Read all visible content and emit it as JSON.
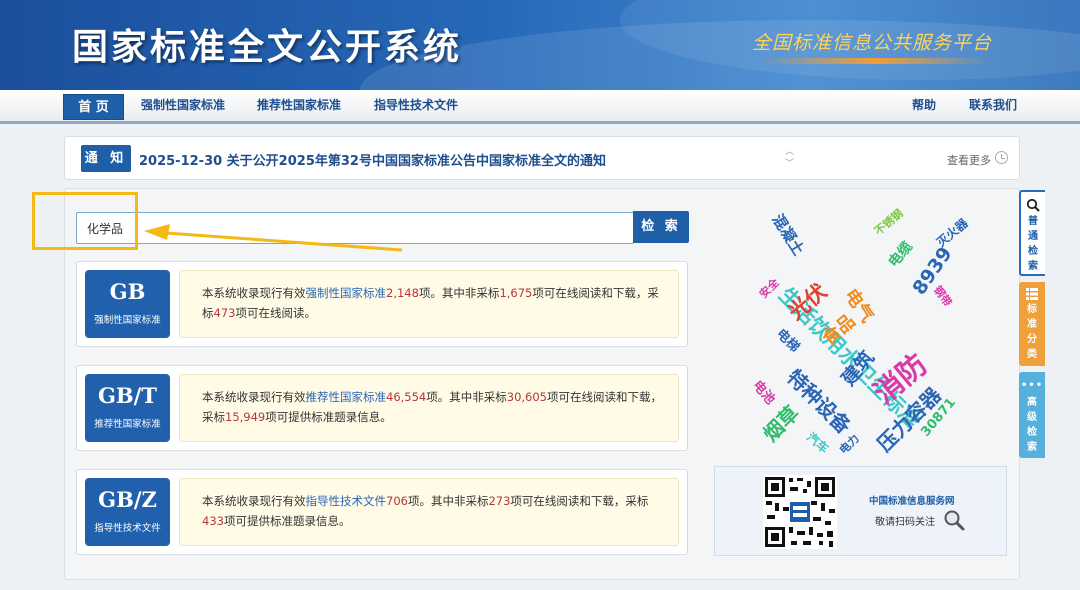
{
  "header": {
    "title": "国家标准全文公开系统",
    "slogan": "全国标准信息公共服务平台"
  },
  "nav": {
    "home": "首 页",
    "items": [
      "强制性国家标准",
      "推荐性国家标准",
      "指导性技术文件"
    ],
    "right": [
      "帮助",
      "联系我们"
    ]
  },
  "notice": {
    "badge": "通 知",
    "text": "2025-12-30  关于公开2025年第32号中国国家标准公告中国家标准全文的通知",
    "more": "查看更多"
  },
  "search": {
    "value": "化学品",
    "button": "检 索"
  },
  "cards": [
    {
      "code": "GB",
      "sub": "强制性国家标准",
      "t1": "本系统收录现行有效",
      "type": "强制性国家标准",
      "total": "2,148",
      "t2": "项。其中非采标",
      "nonadopt": "1,675",
      "t3": "项可在线阅读和下载，采标",
      "adopt": "473",
      "t4": "项可在线阅读。"
    },
    {
      "code": "GB/T",
      "sub": "推荐性国家标准",
      "t1": "本系统收录现行有效",
      "type": "推荐性国家标准",
      "total": "46,554",
      "t2": "项。其中非采标",
      "nonadopt": "30,605",
      "t3": "项可在线阅读和下载，采标",
      "adopt": "15,949",
      "t4": "项可提供标准题录信息。"
    },
    {
      "code": "GB/Z",
      "sub": "指导性技术文件",
      "t1": "本系统收录现行有效",
      "type": "指导性技术文件",
      "total": "706",
      "t2": "项。其中非采标",
      "nonadopt": "273",
      "t3": "项可在线阅读和下载，采标",
      "adopt": "433",
      "t4": "项可提供标准题录信息。"
    }
  ],
  "cloud": {
    "words": [
      "混凝土",
      "生活饮用水卫生标准",
      "不锈钢",
      "灭火器",
      "电缆",
      "8939",
      "安全",
      "光伏",
      "电气",
      "钢带",
      "食品",
      "电梯",
      "建筑",
      "消防",
      "特种设备",
      "电池",
      "压力容器",
      "烟草",
      "汽车",
      "电力",
      "30871"
    ]
  },
  "qr": {
    "title": "中国标准信息服务网",
    "caption": "敬请扫码关注"
  },
  "side": {
    "plain": "普通检索",
    "category": "标准分类",
    "advanced": "高级检索"
  },
  "colors": {
    "primary": "#1e5fa8",
    "highlight": "#f5b915",
    "number": "#b5373a"
  }
}
